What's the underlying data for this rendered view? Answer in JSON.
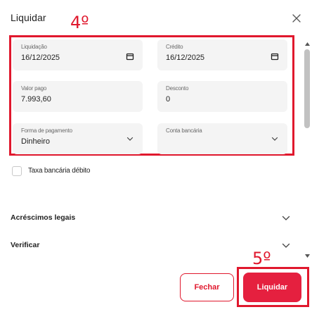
{
  "dialog": {
    "title": "Liquidar"
  },
  "annotations": {
    "step4": "4º",
    "step5": "5º",
    "color": "#e0182d"
  },
  "fields": {
    "liquidacao": {
      "label": "Liquidação",
      "value": "16/12/2025",
      "icon": "calendar-icon"
    },
    "credito": {
      "label": "Crédito",
      "value": "16/12/2025",
      "icon": "calendar-icon"
    },
    "valor_pago": {
      "label": "Valor pago",
      "value": "7.993,60"
    },
    "desconto": {
      "label": "Desconto",
      "value": "0"
    },
    "forma_pagamento": {
      "label": "Forma de pagamento",
      "value": "Dinheiro",
      "icon": "chevron-down-icon"
    },
    "conta_bancaria": {
      "label": "Conta bancária",
      "value": "",
      "icon": "chevron-down-icon"
    }
  },
  "checkbox": {
    "label": "Taxa bancária débito",
    "checked": false
  },
  "accordions": [
    {
      "label": "Acréscimos legais"
    },
    {
      "label": "Verificar"
    }
  ],
  "buttons": {
    "fechar": "Fechar",
    "liquidar": "Liquidar"
  },
  "colors": {
    "accent": "#e5203f",
    "field_bg": "#f4f4f4",
    "scrollbar": "#c1c1c1"
  }
}
